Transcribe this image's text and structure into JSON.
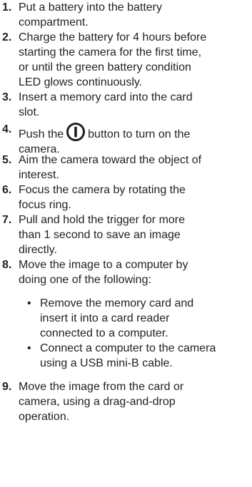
{
  "steps": [
    {
      "number": "1.",
      "lines": [
        "Put a battery into the battery",
        "compartment."
      ]
    },
    {
      "number": "2.",
      "lines": [
        "Charge the battery for 4 hours before",
        "starting the camera for the first time,",
        "or until the green battery condition",
        "LED glows continuously."
      ]
    },
    {
      "number": "3.",
      "lines": [
        "Insert a memory card into the card",
        "slot."
      ]
    },
    {
      "number": "4.",
      "before_icon": "Push the",
      "icon": "power-button-icon",
      "after_icon": "button to turn on the",
      "lines": [
        "camera."
      ]
    },
    {
      "number": "5.",
      "lines": [
        "Aim the camera toward the object of",
        "interest."
      ]
    },
    {
      "number": "6.",
      "lines": [
        "Focus the camera by rotating the",
        "focus ring."
      ]
    },
    {
      "number": "7.",
      "lines": [
        "Pull and hold the trigger for more",
        "than 1 second to save an image",
        "directly."
      ]
    },
    {
      "number": "8.",
      "lines": [
        "Move the image to a computer by",
        "doing one of the following:"
      ],
      "bullets": [
        {
          "lines": [
            "Remove the memory card and",
            "insert it into a card reader",
            "connected to a computer."
          ]
        },
        {
          "lines": [
            "Connect a computer to the camera",
            "using a USB mini-B cable."
          ]
        }
      ]
    },
    {
      "number": "9.",
      "lines": [
        "Move the image from the card or",
        "camera, using a drag-and-drop",
        "operation."
      ]
    }
  ],
  "bullet_symbol": "•",
  "text_color": "#231f20"
}
